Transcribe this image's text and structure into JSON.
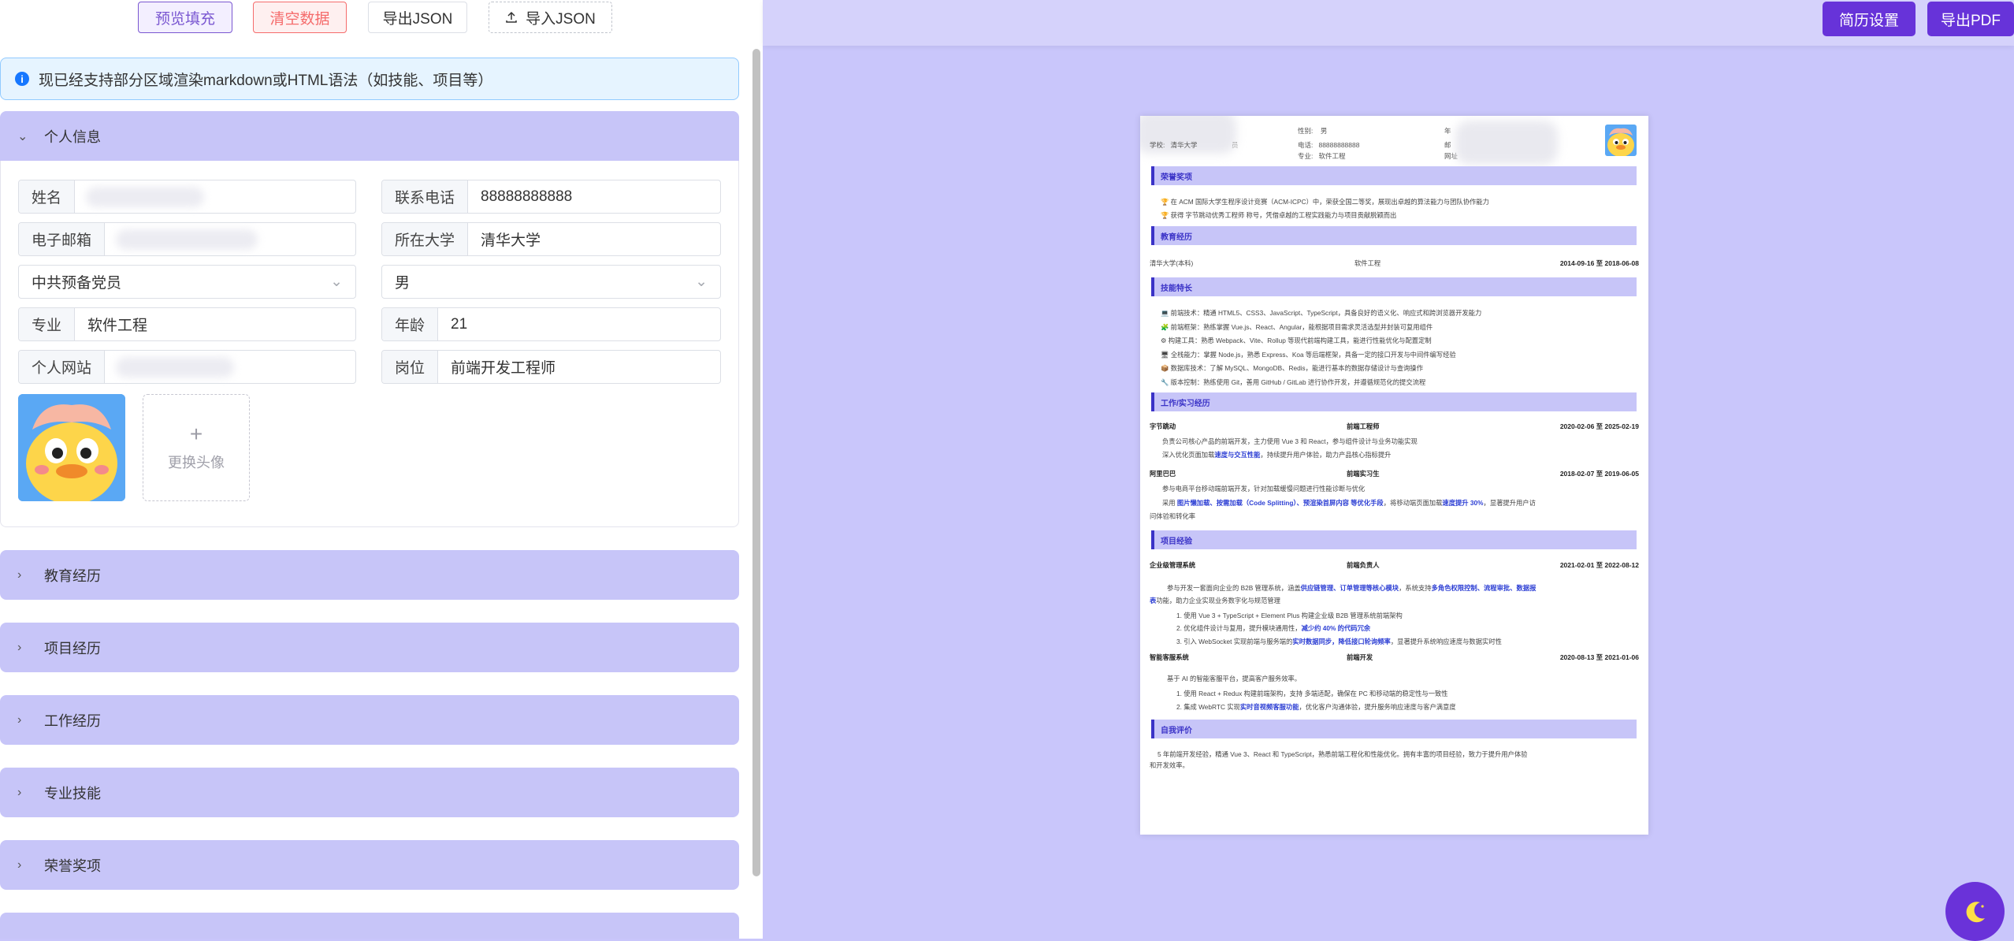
{
  "toolbar": {
    "fill_label": "预览填充",
    "clear_label": "清空数据",
    "export_label": "导出JSON",
    "import_label": "导入JSON"
  },
  "notice": "现已经支持部分区域渲染markdown或HTML语法（如技能、项目等）",
  "personal": {
    "title": "个人信息",
    "name_label": "姓名",
    "phone_label": "联系电话",
    "phone_value": "88888888888",
    "email_label": "电子邮箱",
    "university_label": "所在大学",
    "university_value": "清华大学",
    "political_value": "中共预备党员",
    "gender_value": "男",
    "major_label": "专业",
    "major_value": "软件工程",
    "age_label": "年龄",
    "age_value": "21",
    "website_label": "个人网站",
    "position_label": "岗位",
    "position_value": "前端开发工程师",
    "change_avatar": "更换头像"
  },
  "sections": {
    "education": "教育经历",
    "projects": "项目经历",
    "work": "工作经历",
    "skills": "专业技能",
    "honors": "荣誉奖项"
  },
  "right_toolbar": {
    "settings_label": "简历设置",
    "pdf_label": "导出PDF"
  },
  "resume": {
    "header": {
      "school_label": "学校:",
      "school_value": "清华大学",
      "title_frag": "员",
      "gender_label": "性别:",
      "gender_value": "男",
      "phone_label": "电话:",
      "phone_value": "88888888888",
      "major_label": "专业:",
      "major_value": "软件工程",
      "age_frag": "年",
      "email_frag": "邮",
      "site_frag": "网址"
    },
    "honors_title": "荣誉奖项",
    "honors": [
      "在 ACM 国际大学生程序设计竞赛（ACM-ICPC）中，荣获全国二等奖，展现出卓越的算法能力与团队协作能力",
      "获得 字节跳动优秀工程师 称号，凭借卓越的工程实践能力与项目贡献脱颖而出"
    ],
    "education_title": "教育经历",
    "education": {
      "school": "清华大学(本科)",
      "major": "软件工程",
      "period": "2014-09-16 至 2018-06-08"
    },
    "skills_title": "技能特长",
    "skills": [
      "前端技术：精通 HTML5、CSS3、JavaScript、TypeScript，具备良好的语义化、响应式和跨浏览器开发能力",
      "前端框架：熟练掌握 Vue.js、React、Angular，能根据项目需求灵活选型并封装可复用组件",
      "构建工具：熟悉 Webpack、Vite、Rollup 等现代前端构建工具，能进行性能优化与配置定制",
      "全栈能力：掌握 Node.js，熟悉 Express、Koa 等后端框架，具备一定的接口开发与中间件编写经验",
      "数据库技术：了解 MySQL、MongoDB、Redis，能进行基本的数据存储设计与查询操作",
      "版本控制：熟练使用 Git，善用 GitHub / GitLab 进行协作开发，并遵循规范化的提交流程"
    ],
    "work_title": "工作/实习经历",
    "work": [
      {
        "company": "字节跳动",
        "role": "前端工程师",
        "period": "2020-02-06 至 2025-02-19",
        "l1": "负责公司核心产品的前端开发，主力使用 Vue 3 和 React，参与组件设计与业务功能实现",
        "l2a": "深入优化页面加载",
        "l2b": "速度与交互性能",
        "l2c": "，持续提升用户体验，助力产品核心指标提升"
      },
      {
        "company": "阿里巴巴",
        "role": "前端实习生",
        "period": "2018-02-07 至 2019-06-05",
        "l1": "参与电商平台移动端前端开发，针对加载缓慢问题进行性能诊断与优化",
        "l2a": "采用 ",
        "l2b": "图片懒加载、按需加载（Code Splitting）、预渲染首屏内容 等优化手段",
        "l2c": "，将移动端页面加载",
        "l2d": "速度提升 30%",
        "l2e": "，显著提升用户访",
        "l3": "问体验和转化率"
      }
    ],
    "projects_title": "项目经验",
    "projects": [
      {
        "name": "企业级管理系统",
        "role": "前端负责人",
        "period": "2021-02-01 至 2022-08-12",
        "intro_a": "参与开发一套面向企业的 B2B 管理系统，涵盖",
        "intro_b": "供应链管理、订单管理等核心模块",
        "intro_c": "，系统支持",
        "intro_d": "多角色权限控制、流程审批、数据报",
        "intro_e": "表",
        "intro_f": "功能，助力企业实现业务数字化与规范管理",
        "items": [
          "1. 使用 Vue 3 + TypeScript + Element Plus 构建企业级 B2B 管理系统前端架构",
          "2. 优化组件设计与复用，提升模块通用性，",
          "3. 引入 WebSocket 实现前端与服务端的"
        ],
        "item2_hl": "减少约 40% 的代码冗余",
        "item3_hl1": "实时数据同步，降低接口轮询频率",
        "item3_rest": "，显著提升系统响应速度与数据实时性"
      },
      {
        "name": "智能客服系统",
        "role": "前端开发",
        "period": "2020-08-13 至 2021-01-06",
        "intro": "基于 AI 的智能客服平台，提高客户服务效率。",
        "item1": "1. 使用 React + Redux 构建前端架构，支持 多端适配，确保在 PC 和移动端的稳定性与一致性",
        "item2a": "2. 集成 WebRTC 实现",
        "item2b": "实时音视频客服功能",
        "item2c": "，优化客户沟通体验，提升服务响应速度与客户满意度"
      }
    ],
    "eval_title": "自我评价",
    "eval_1": "5 年前端开发经验，精通 Vue 3、React 和 TypeScript，熟悉前端工程化和性能优化。拥有丰富的项目经验，致力于提升用户体验",
    "eval_2": "和开发效率。"
  },
  "colors": {
    "accent": "#6733d9",
    "section_bg": "#c7c5f8",
    "highlight": "#2d3fd4"
  }
}
